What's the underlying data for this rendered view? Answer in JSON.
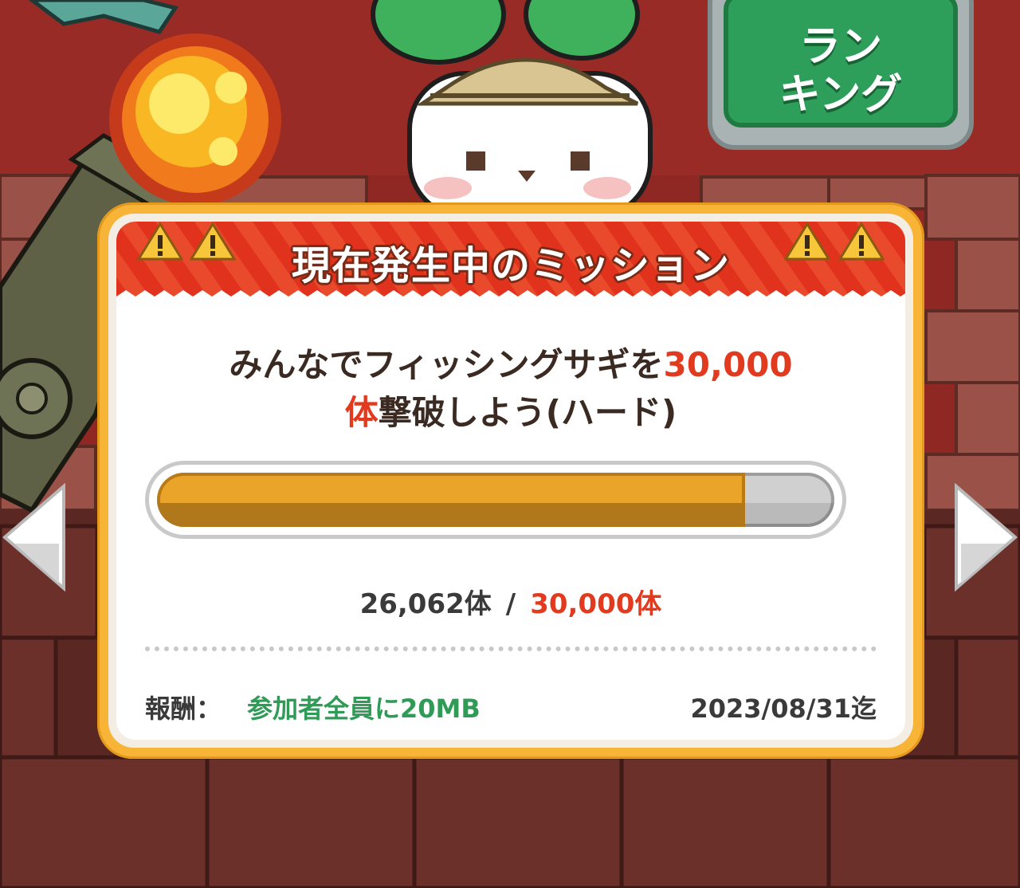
{
  "ranking_button": {
    "label": "ラン\nキング"
  },
  "mission": {
    "header_title": "現在発生中のミッション",
    "description": {
      "line1_prefix": "みんなでフィッシングサギを",
      "line1_target": "30,000",
      "line2_unit": "体",
      "line2_suffix": "撃破しよう(ハード)"
    },
    "progress": {
      "current": 26062,
      "target": 30000,
      "fraction": 0.8687
    },
    "count": {
      "current_text": "26,062体",
      "separator": "/",
      "target_text": "30,000体"
    },
    "reward": {
      "label": "報酬：",
      "value": "参加者全員に20MB"
    },
    "deadline": "2023/08/31迄"
  },
  "colors": {
    "accent_red": "#e23a1e",
    "reward_green": "#2f9b57",
    "card_orange": "#f7b437",
    "progress_fill": "#eaa42a",
    "header_red": "#e0321c"
  },
  "icons": {
    "left": "chevron-left-icon",
    "right": "chevron-right-icon",
    "warning": "warning-icon"
  }
}
